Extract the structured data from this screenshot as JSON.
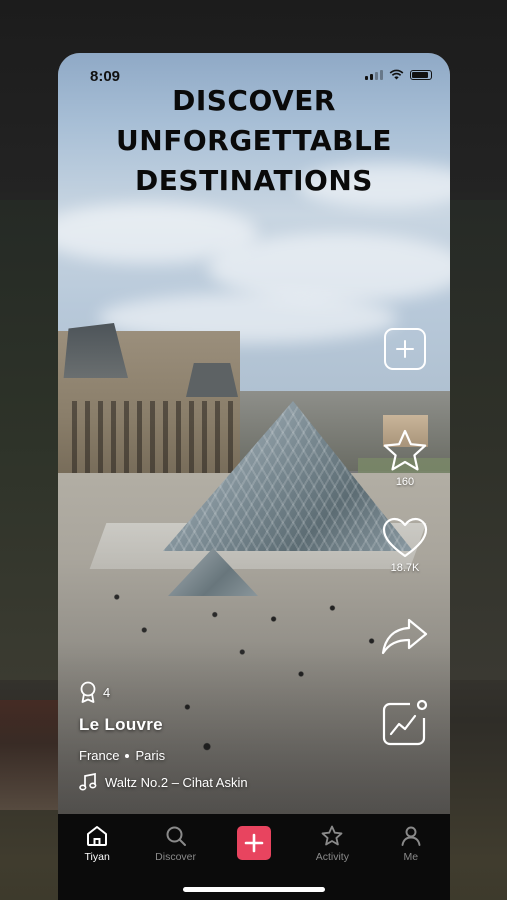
{
  "status": {
    "time": "8:09"
  },
  "headline": [
    "DISCOVER",
    "UNFORGETTABLE",
    "DESTINATIONS"
  ],
  "actions": {
    "add_icon": "plus-square-icon",
    "star_count": "160",
    "like_count": "18.7K",
    "share_icon": "share-arrow-icon",
    "stats_icon": "trending-chart-icon"
  },
  "post": {
    "award_count": "4",
    "place": "Le Louvre",
    "country": "France",
    "city": "Paris",
    "music": "Waltz No.2 – Cihat  Askin"
  },
  "tabs": [
    {
      "label": "Tiyan",
      "icon": "home-icon",
      "active": true
    },
    {
      "label": "Discover",
      "icon": "search-icon",
      "active": false
    },
    {
      "label": "",
      "icon": "plus-icon",
      "active": false
    },
    {
      "label": "Activity",
      "icon": "star-icon",
      "active": false
    },
    {
      "label": "Me",
      "icon": "user-icon",
      "active": false
    }
  ],
  "colors": {
    "create": "#e8445f",
    "tabbar": "#0b0b0b"
  }
}
